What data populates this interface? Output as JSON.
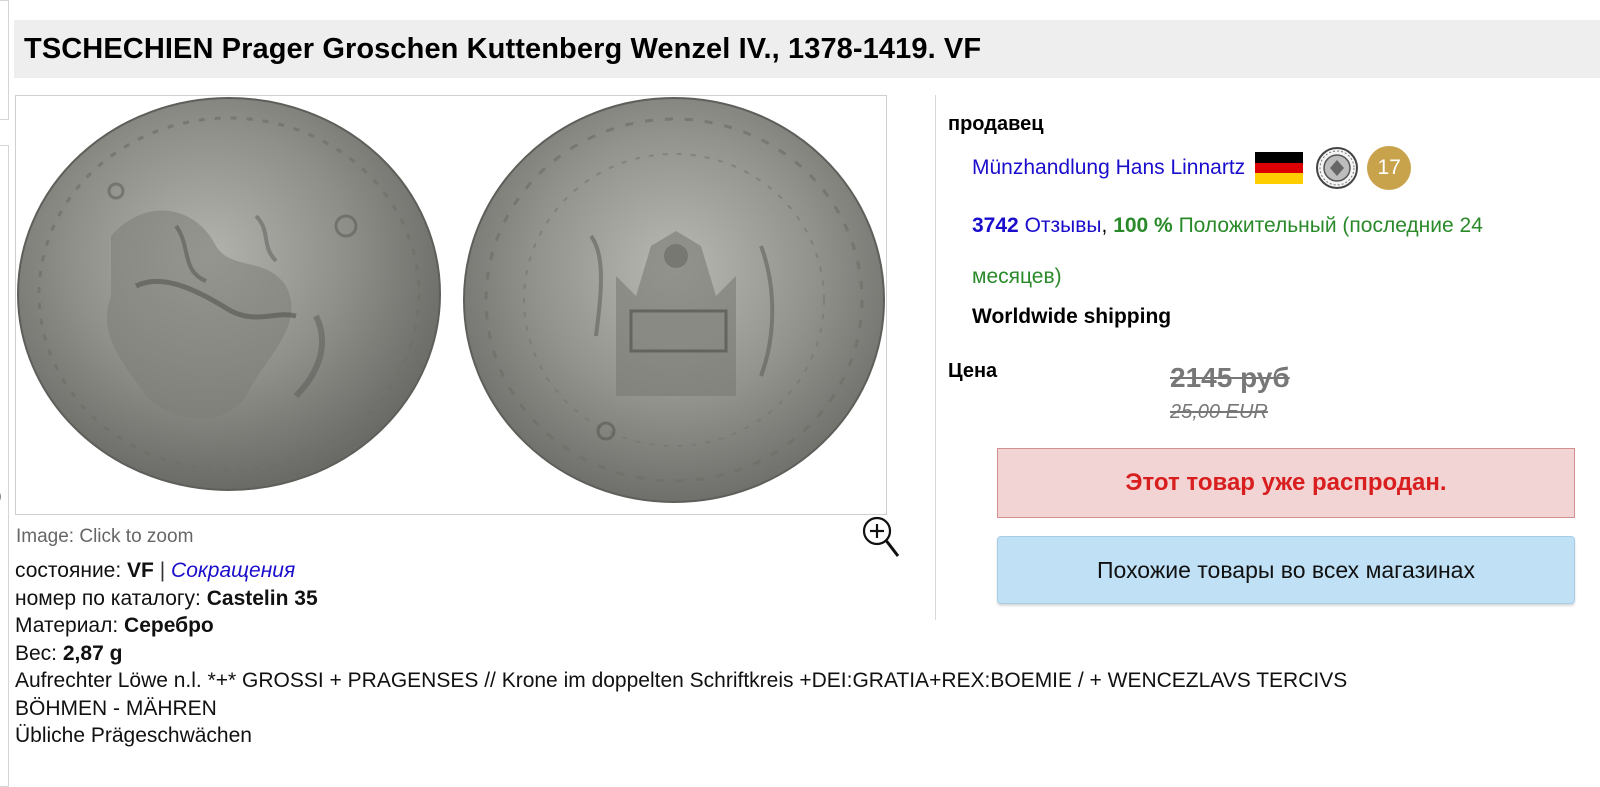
{
  "product": {
    "title": "TSCHECHIEN Prager Groschen Kuttenberg Wenzel IV., 1378-1419. VF"
  },
  "image": {
    "caption": "Image: Click to zoom",
    "left_edge_glyph": ")"
  },
  "details": {
    "condition_label": "состояние:",
    "condition_value": "VF",
    "separator": "|",
    "abbreviations_link": "Сокращения",
    "catalog_label": "номер по каталогу:",
    "catalog_value": "Castelin 35",
    "material_label": "Материал:",
    "material_value": "Серебро",
    "weight_label": "Вес:",
    "weight_value": "2,87 g",
    "description_line1": "Aufrechter Löwe n.l. *+* GROSSI + PRAGENSES // Krone im doppelten Schriftkreis +DEI:GRATIA+REX:BOEMIE / + WENCEZLAVS TERCIVS",
    "description_line2": "BÖHMEN - MÄHREN",
    "description_line3": "Übliche Prägeschwächen"
  },
  "seller": {
    "label": "продавец",
    "name": "Münzhandlung Hans Linnartz",
    "badge_count": "17",
    "feedback_count": "3742",
    "feedback_label": "Отзывы",
    "comma": ",",
    "positive_pct": "100 %",
    "positive_label": "Положительный (последние 24 месяцев)",
    "shipping": "Worldwide shipping"
  },
  "price": {
    "label": "Цена",
    "rub": "2145 руб",
    "eur": "25,00 EUR"
  },
  "status": {
    "sold_out": "Этот товар уже распродан."
  },
  "actions": {
    "similar_items": "Похожие товары во всех магазинах"
  },
  "icons": {
    "zoom": "magnifier-plus-icon",
    "flag": "germany-flag-icon",
    "seal": "dealer-association-seal-icon"
  },
  "colors": {
    "link": "#1a0dcc",
    "positive": "#2a8a2a",
    "sold_text": "#d81e1e",
    "sold_bg": "#f2d4d4",
    "button_bg": "#bfe0f5",
    "badge": "#c9a34b",
    "title_bg": "#eeeeee"
  }
}
